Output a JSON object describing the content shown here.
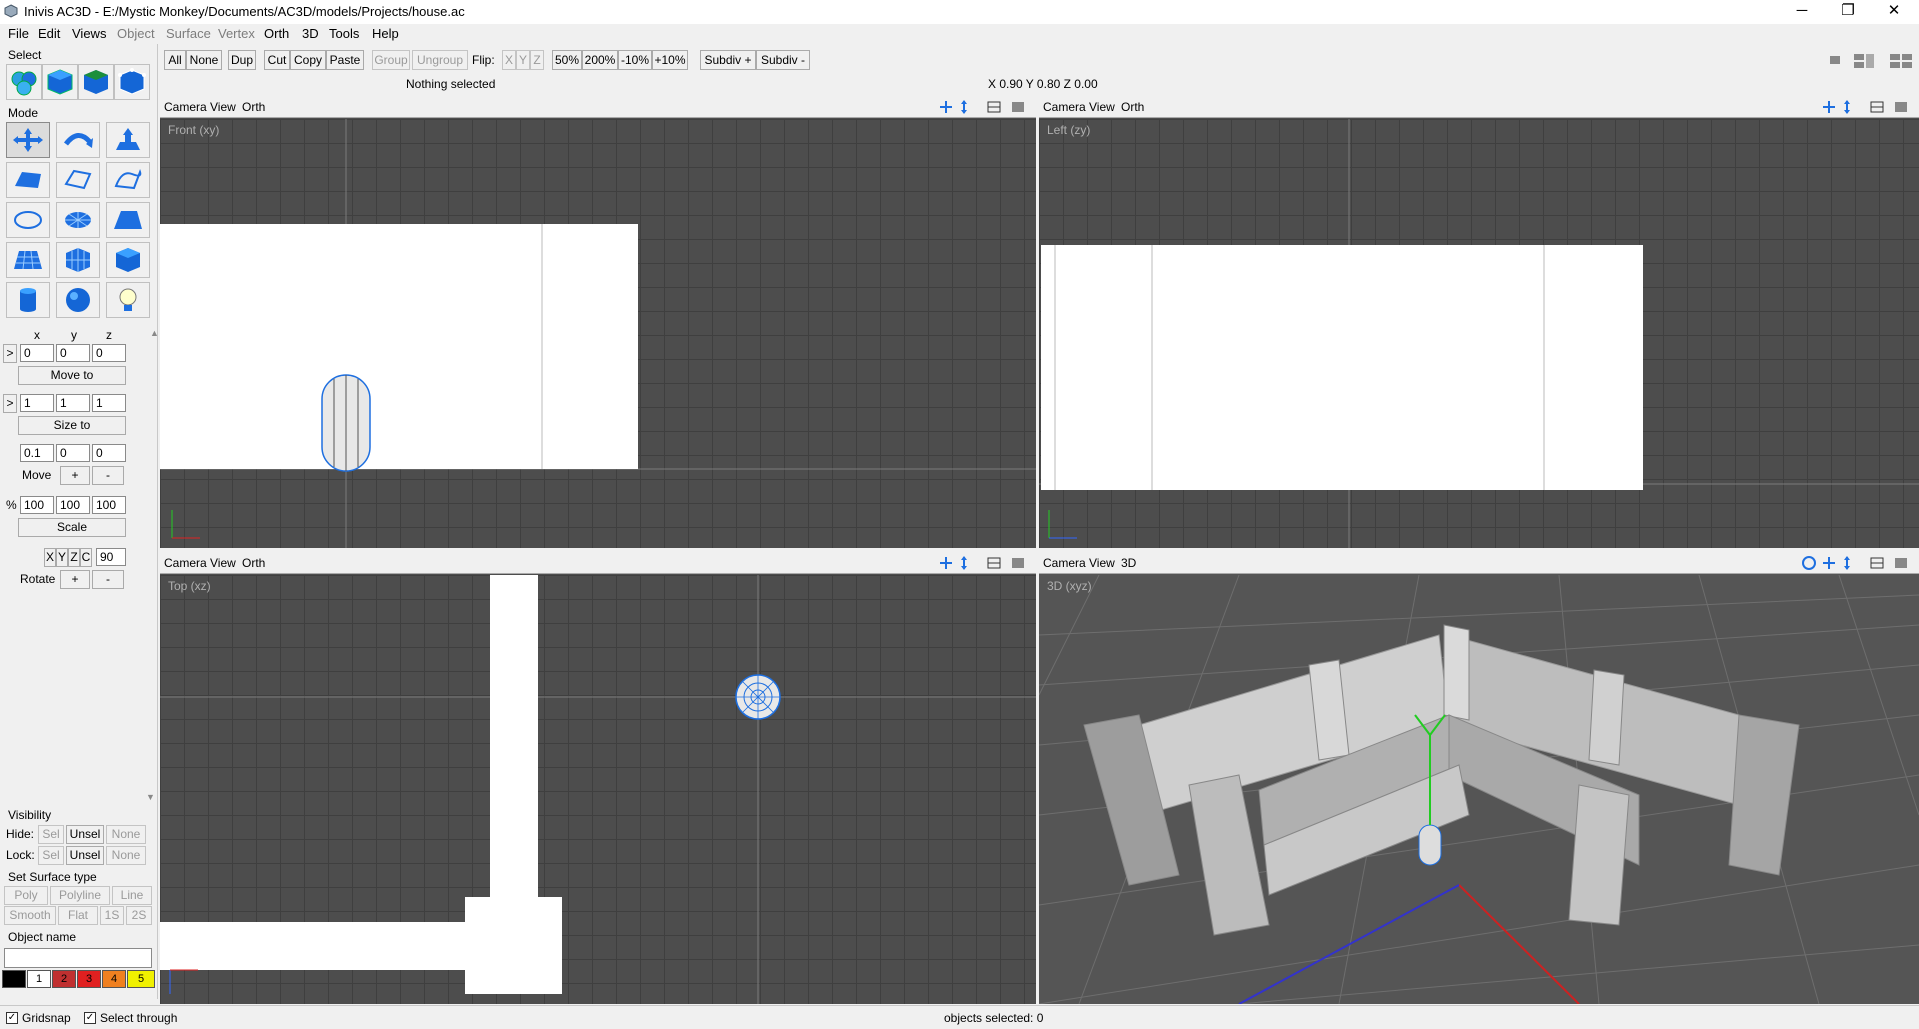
{
  "window": {
    "title": "Inivis AC3D - E:/Mystic Monkey/Documents/AC3D/models/Projects/house.ac",
    "minimize": "─",
    "maximize": "❐",
    "close": "✕"
  },
  "menu": [
    "File",
    "Edit",
    "Views",
    "Object",
    "Surface",
    "Vertex",
    "Orth",
    "3D",
    "Tools",
    "Help"
  ],
  "left": {
    "select_label": "Select",
    "mode_label": "Mode",
    "axis_labels": [
      "x",
      "y",
      "z"
    ],
    "moveto": {
      "arrow": ">",
      "x": "0",
      "y": "0",
      "z": "0",
      "button": "Move to"
    },
    "sizeto": {
      "arrow": ">",
      "x": "1",
      "y": "1",
      "z": "1",
      "button": "Size to"
    },
    "move": {
      "x": "0.1",
      "y": "0",
      "z": "0",
      "label": "Move",
      "plus": "+",
      "minus": "-"
    },
    "scale": {
      "pct": "%",
      "x": "100",
      "y": "100",
      "z": "100",
      "button": "Scale"
    },
    "rotate": {
      "x": "X",
      "y": "Y",
      "z": "Z",
      "c": "C",
      "angle": "90",
      "label": "Rotate",
      "plus": "+",
      "minus": "-"
    },
    "visibility": {
      "label": "Visibility",
      "hide_label": "Hide:",
      "lock_label": "Lock:",
      "sel": "Sel",
      "unsel": "Unsel",
      "none": "None"
    },
    "surface": {
      "label": "Set Surface type",
      "poly": "Poly",
      "polyline": "Polyline",
      "line": "Line",
      "smooth": "Smooth",
      "flat": "Flat",
      "s1": "1S",
      "s2": "2S"
    },
    "object_name_label": "Object name",
    "object_name_value": "",
    "palette": [
      {
        "label": "",
        "color": "#000000"
      },
      {
        "label": "1",
        "color": "#ffffff"
      },
      {
        "label": "2",
        "color": "#c03030"
      },
      {
        "label": "3",
        "color": "#e02020"
      },
      {
        "label": "4",
        "color": "#f08020"
      },
      {
        "label": "5",
        "color": "#f0f000"
      }
    ]
  },
  "toolbar": {
    "all": "All",
    "none": "None",
    "dup": "Dup",
    "cut": "Cut",
    "copy": "Copy",
    "paste": "Paste",
    "group": "Group",
    "ungroup": "Ungroup",
    "flip": "Flip:",
    "fx": "X",
    "fy": "Y",
    "fz": "Z",
    "z50": "50%",
    "z200": "200%",
    "zm10": "-10%",
    "zp10": "+10%",
    "subdiv_plus": "Subdiv +",
    "subdiv_minus": "Subdiv -",
    "selection_status": "Nothing selected",
    "coords": "X 0.90 Y 0.80 Z 0.00"
  },
  "viewports": {
    "front": {
      "camera": "Camera",
      "view": "View",
      "mode": "Orth",
      "label": "Front (xy)"
    },
    "left": {
      "camera": "Camera",
      "view": "View",
      "mode": "Orth",
      "label": "Left (zy)"
    },
    "top": {
      "camera": "Camera",
      "view": "View",
      "mode": "Orth",
      "label": "Top (xz)"
    },
    "threed": {
      "camera": "Camera",
      "view": "View",
      "mode": "3D",
      "label": "3D (xyz)"
    }
  },
  "status": {
    "gridsnap": "Gridsnap",
    "select_through": "Select through",
    "objects_selected": "objects selected: 0"
  }
}
